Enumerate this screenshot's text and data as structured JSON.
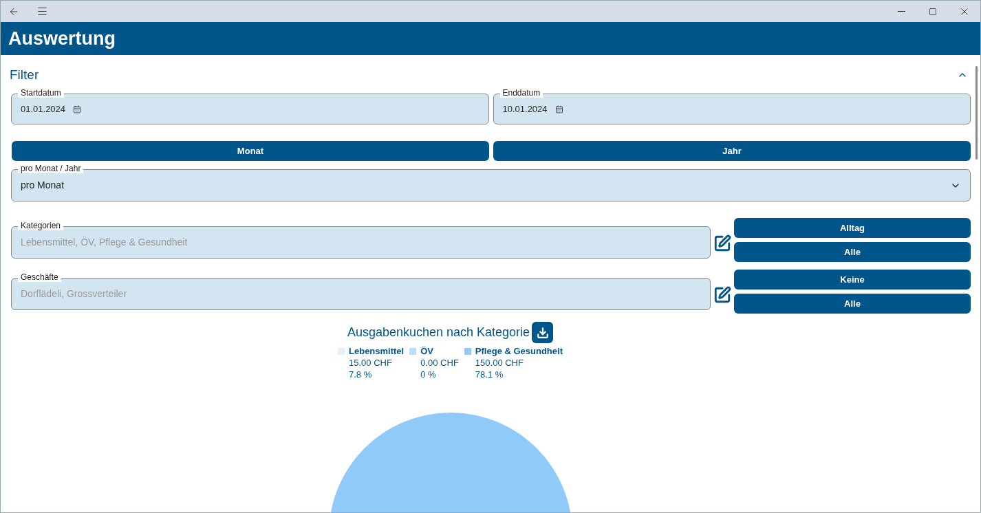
{
  "header": {
    "title": "Auswertung"
  },
  "filter": {
    "title": "Filter",
    "expanded": true,
    "date_fields": [
      {
        "label": "Startdatum",
        "value": "01.01.2024"
      },
      {
        "label": "Enddatum",
        "value": "10.01.2024"
      }
    ],
    "period_buttons": [
      "Monat",
      "Jahr"
    ],
    "period_select": {
      "label": "pro Monat / Jahr",
      "value": "pro Monat"
    },
    "selectors": [
      {
        "label": "Kategorien",
        "value": "Lebensmittel, ÖV, Pflege & Gesundheit",
        "buttons": [
          "Alltag",
          "Alle"
        ]
      },
      {
        "label": "Geschäfte",
        "value": "Dorflädeli, Grossverteiler",
        "buttons": [
          "Keine",
          "Alle"
        ]
      }
    ]
  },
  "chart": {
    "title": "Ausgabenkuchen nach Kategorie",
    "legend": [
      {
        "label": "Lebensmittel",
        "color": "#e3f0fc",
        "amount": "15.00 CHF",
        "percent": "7.8 %"
      },
      {
        "label": "ÖV",
        "color": "#bbdefb",
        "amount": "0.00 CHF",
        "percent": "0 %"
      },
      {
        "label": "Pflege & Gesundheit",
        "color": "#90caf9",
        "amount": "150.00 CHF",
        "percent": "78.1 %"
      }
    ]
  }
}
